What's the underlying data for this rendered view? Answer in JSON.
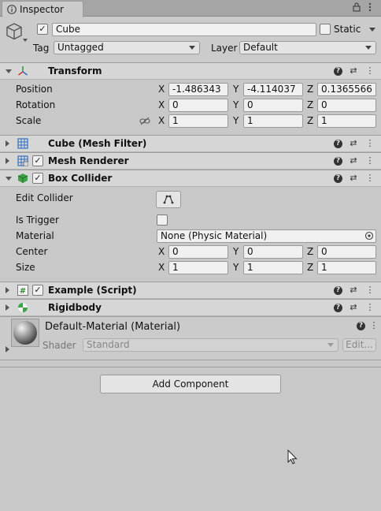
{
  "tab": {
    "title": "Inspector",
    "lock_icon": "lock-icon",
    "menu_icon": "kebab-menu-icon"
  },
  "object": {
    "icon": "cube-icon",
    "active": true,
    "name": "Cube",
    "static_label": "Static",
    "static": false,
    "tag_label": "Tag",
    "tag_value": "Untagged",
    "layer_label": "Layer",
    "layer_value": "Default"
  },
  "transform": {
    "title": "Transform",
    "position_label": "Position",
    "rotation_label": "Rotation",
    "scale_label": "Scale",
    "axes": [
      "X",
      "Y",
      "Z"
    ],
    "position": [
      "-1.486343",
      "-4.114037",
      "0.1365566"
    ],
    "rotation": [
      "0",
      "0",
      "0"
    ],
    "scale": [
      "1",
      "1",
      "1"
    ]
  },
  "mesh_filter": {
    "title": "Cube (Mesh Filter)"
  },
  "mesh_renderer": {
    "title": "Mesh Renderer",
    "enabled": true
  },
  "box_collider": {
    "title": "Box Collider",
    "enabled": true,
    "edit_collider_label": "Edit Collider",
    "is_trigger_label": "Is Trigger",
    "is_trigger": false,
    "material_label": "Material",
    "material_value": "None (Physic Material)",
    "center_label": "Center",
    "size_label": "Size",
    "center": [
      "0",
      "0",
      "0"
    ],
    "size": [
      "1",
      "1",
      "1"
    ]
  },
  "script": {
    "title": "Example (Script)",
    "enabled": true
  },
  "rigidbody": {
    "title": "Rigidbody"
  },
  "material": {
    "title": "Default-Material (Material)",
    "shader_label": "Shader",
    "shader_value": "Standard",
    "edit_label": "Edit..."
  },
  "add_component_label": "Add Component",
  "colors": {
    "background": "#c8c8c8",
    "header": "#d6d6d6",
    "field": "#f0f0f0",
    "transform_icon_green": "#2ea043",
    "transform_icon_red": "#d23a2a",
    "mesh_icon_blue": "#2f6fc4",
    "collider_icon_green": "#3ea24a"
  }
}
